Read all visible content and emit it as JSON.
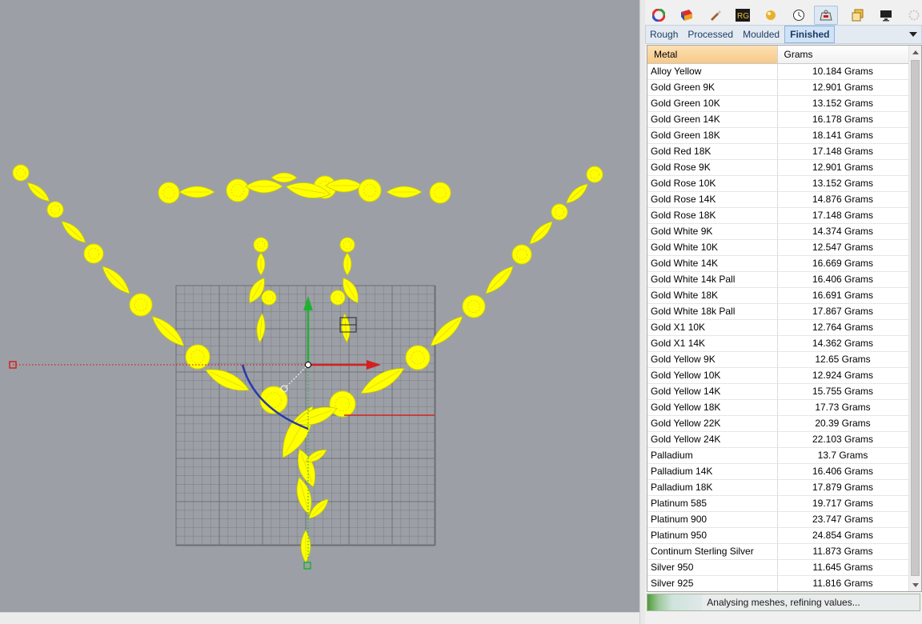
{
  "toolbar": {
    "icons": [
      "color-wheel-icon",
      "render-icon",
      "brush-icon",
      "rg-plugin-icon",
      "material-icon",
      "clock-icon",
      "weight-calculator-icon",
      "layers-icon",
      "display-icon",
      "settings-icon"
    ],
    "rg_label": "RG"
  },
  "tabs": [
    "Rough",
    "Processed",
    "Moulded",
    "Finished"
  ],
  "active_tab": "Finished",
  "table": {
    "headers": [
      "Metal",
      "Grams"
    ],
    "rows": [
      {
        "metal": "Alloy Yellow",
        "grams": "10.184 Grams"
      },
      {
        "metal": "Gold Green 9K",
        "grams": "12.901 Grams"
      },
      {
        "metal": "Gold Green 10K",
        "grams": "13.152 Grams"
      },
      {
        "metal": "Gold Green 14K",
        "grams": "16.178 Grams"
      },
      {
        "metal": "Gold Green 18K",
        "grams": "18.141 Grams"
      },
      {
        "metal": "Gold Red 18K",
        "grams": "17.148 Grams"
      },
      {
        "metal": "Gold Rose 9K",
        "grams": "12.901 Grams"
      },
      {
        "metal": "Gold Rose 10K",
        "grams": "13.152 Grams"
      },
      {
        "metal": "Gold Rose 14K",
        "grams": "14.876 Grams"
      },
      {
        "metal": "Gold Rose 18K",
        "grams": "17.148 Grams"
      },
      {
        "metal": "Gold White 9K",
        "grams": "14.374 Grams"
      },
      {
        "metal": "Gold White 10K",
        "grams": "12.547 Grams"
      },
      {
        "metal": "Gold White 14K",
        "grams": "16.669 Grams"
      },
      {
        "metal": "Gold White 14k Pall",
        "grams": "16.406 Grams"
      },
      {
        "metal": "Gold White 18K",
        "grams": "16.691 Grams"
      },
      {
        "metal": "Gold White 18k Pall",
        "grams": "17.867 Grams"
      },
      {
        "metal": "Gold X1 10K",
        "grams": "12.764 Grams"
      },
      {
        "metal": "Gold X1 14K",
        "grams": "14.362 Grams"
      },
      {
        "metal": "Gold Yellow 9K",
        "grams": "12.65 Grams"
      },
      {
        "metal": "Gold Yellow 10K",
        "grams": "12.924 Grams"
      },
      {
        "metal": "Gold Yellow 14K",
        "grams": "15.755 Grams"
      },
      {
        "metal": "Gold Yellow 18K",
        "grams": "17.73 Grams"
      },
      {
        "metal": "Gold Yellow 22K",
        "grams": "20.39 Grams"
      },
      {
        "metal": "Gold Yellow 24K",
        "grams": "22.103 Grams"
      },
      {
        "metal": "Palladium",
        "grams": "13.7 Grams"
      },
      {
        "metal": "Palladium 14K",
        "grams": "16.406 Grams"
      },
      {
        "metal": "Palladium 18K",
        "grams": "17.879 Grams"
      },
      {
        "metal": "Platinum 585",
        "grams": "19.717 Grams"
      },
      {
        "metal": "Platinum 900",
        "grams": "23.747 Grams"
      },
      {
        "metal": "Platinum 950",
        "grams": "24.854 Grams"
      },
      {
        "metal": "Continum Sterling Silver",
        "grams": "11.873 Grams"
      },
      {
        "metal": "Silver 950",
        "grams": "11.645 Grams"
      },
      {
        "metal": "Silver 925",
        "grams": "11.816 Grams"
      }
    ]
  },
  "status": {
    "text": "Analysing meshes, refining values...",
    "progress": 0.2
  },
  "viewport": {
    "background": "#9ca0a6",
    "model_color": "#ffff00",
    "x_axis_color": "#d42020",
    "y_axis_color": "#20b030",
    "grid_color": "#7f8388"
  }
}
